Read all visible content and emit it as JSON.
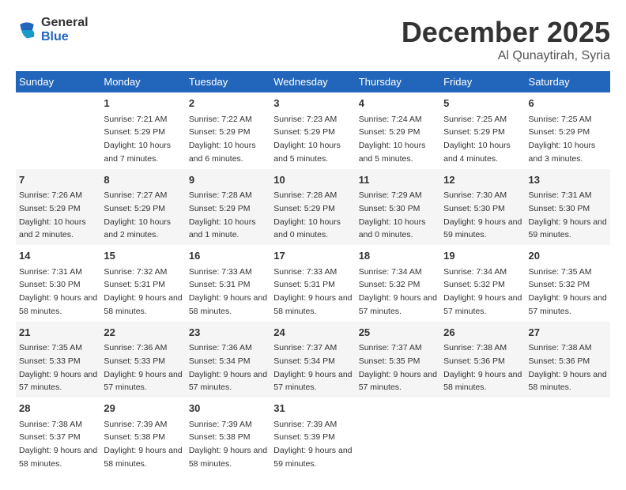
{
  "header": {
    "logo_line1": "General",
    "logo_line2": "Blue",
    "month": "December 2025",
    "location": "Al Qunaytirah, Syria"
  },
  "weekdays": [
    "Sunday",
    "Monday",
    "Tuesday",
    "Wednesday",
    "Thursday",
    "Friday",
    "Saturday"
  ],
  "weeks": [
    [
      {
        "day": "",
        "sunrise": "",
        "sunset": "",
        "daylight": ""
      },
      {
        "day": "1",
        "sunrise": "Sunrise: 7:21 AM",
        "sunset": "Sunset: 5:29 PM",
        "daylight": "Daylight: 10 hours and 7 minutes."
      },
      {
        "day": "2",
        "sunrise": "Sunrise: 7:22 AM",
        "sunset": "Sunset: 5:29 PM",
        "daylight": "Daylight: 10 hours and 6 minutes."
      },
      {
        "day": "3",
        "sunrise": "Sunrise: 7:23 AM",
        "sunset": "Sunset: 5:29 PM",
        "daylight": "Daylight: 10 hours and 5 minutes."
      },
      {
        "day": "4",
        "sunrise": "Sunrise: 7:24 AM",
        "sunset": "Sunset: 5:29 PM",
        "daylight": "Daylight: 10 hours and 5 minutes."
      },
      {
        "day": "5",
        "sunrise": "Sunrise: 7:25 AM",
        "sunset": "Sunset: 5:29 PM",
        "daylight": "Daylight: 10 hours and 4 minutes."
      },
      {
        "day": "6",
        "sunrise": "Sunrise: 7:25 AM",
        "sunset": "Sunset: 5:29 PM",
        "daylight": "Daylight: 10 hours and 3 minutes."
      }
    ],
    [
      {
        "day": "7",
        "sunrise": "Sunrise: 7:26 AM",
        "sunset": "Sunset: 5:29 PM",
        "daylight": "Daylight: 10 hours and 2 minutes."
      },
      {
        "day": "8",
        "sunrise": "Sunrise: 7:27 AM",
        "sunset": "Sunset: 5:29 PM",
        "daylight": "Daylight: 10 hours and 2 minutes."
      },
      {
        "day": "9",
        "sunrise": "Sunrise: 7:28 AM",
        "sunset": "Sunset: 5:29 PM",
        "daylight": "Daylight: 10 hours and 1 minute."
      },
      {
        "day": "10",
        "sunrise": "Sunrise: 7:28 AM",
        "sunset": "Sunset: 5:29 PM",
        "daylight": "Daylight: 10 hours and 0 minutes."
      },
      {
        "day": "11",
        "sunrise": "Sunrise: 7:29 AM",
        "sunset": "Sunset: 5:30 PM",
        "daylight": "Daylight: 10 hours and 0 minutes."
      },
      {
        "day": "12",
        "sunrise": "Sunrise: 7:30 AM",
        "sunset": "Sunset: 5:30 PM",
        "daylight": "Daylight: 9 hours and 59 minutes."
      },
      {
        "day": "13",
        "sunrise": "Sunrise: 7:31 AM",
        "sunset": "Sunset: 5:30 PM",
        "daylight": "Daylight: 9 hours and 59 minutes."
      }
    ],
    [
      {
        "day": "14",
        "sunrise": "Sunrise: 7:31 AM",
        "sunset": "Sunset: 5:30 PM",
        "daylight": "Daylight: 9 hours and 58 minutes."
      },
      {
        "day": "15",
        "sunrise": "Sunrise: 7:32 AM",
        "sunset": "Sunset: 5:31 PM",
        "daylight": "Daylight: 9 hours and 58 minutes."
      },
      {
        "day": "16",
        "sunrise": "Sunrise: 7:33 AM",
        "sunset": "Sunset: 5:31 PM",
        "daylight": "Daylight: 9 hours and 58 minutes."
      },
      {
        "day": "17",
        "sunrise": "Sunrise: 7:33 AM",
        "sunset": "Sunset: 5:31 PM",
        "daylight": "Daylight: 9 hours and 58 minutes."
      },
      {
        "day": "18",
        "sunrise": "Sunrise: 7:34 AM",
        "sunset": "Sunset: 5:32 PM",
        "daylight": "Daylight: 9 hours and 57 minutes."
      },
      {
        "day": "19",
        "sunrise": "Sunrise: 7:34 AM",
        "sunset": "Sunset: 5:32 PM",
        "daylight": "Daylight: 9 hours and 57 minutes."
      },
      {
        "day": "20",
        "sunrise": "Sunrise: 7:35 AM",
        "sunset": "Sunset: 5:32 PM",
        "daylight": "Daylight: 9 hours and 57 minutes."
      }
    ],
    [
      {
        "day": "21",
        "sunrise": "Sunrise: 7:35 AM",
        "sunset": "Sunset: 5:33 PM",
        "daylight": "Daylight: 9 hours and 57 minutes."
      },
      {
        "day": "22",
        "sunrise": "Sunrise: 7:36 AM",
        "sunset": "Sunset: 5:33 PM",
        "daylight": "Daylight: 9 hours and 57 minutes."
      },
      {
        "day": "23",
        "sunrise": "Sunrise: 7:36 AM",
        "sunset": "Sunset: 5:34 PM",
        "daylight": "Daylight: 9 hours and 57 minutes."
      },
      {
        "day": "24",
        "sunrise": "Sunrise: 7:37 AM",
        "sunset": "Sunset: 5:34 PM",
        "daylight": "Daylight: 9 hours and 57 minutes."
      },
      {
        "day": "25",
        "sunrise": "Sunrise: 7:37 AM",
        "sunset": "Sunset: 5:35 PM",
        "daylight": "Daylight: 9 hours and 57 minutes."
      },
      {
        "day": "26",
        "sunrise": "Sunrise: 7:38 AM",
        "sunset": "Sunset: 5:36 PM",
        "daylight": "Daylight: 9 hours and 58 minutes."
      },
      {
        "day": "27",
        "sunrise": "Sunrise: 7:38 AM",
        "sunset": "Sunset: 5:36 PM",
        "daylight": "Daylight: 9 hours and 58 minutes."
      }
    ],
    [
      {
        "day": "28",
        "sunrise": "Sunrise: 7:38 AM",
        "sunset": "Sunset: 5:37 PM",
        "daylight": "Daylight: 9 hours and 58 minutes."
      },
      {
        "day": "29",
        "sunrise": "Sunrise: 7:39 AM",
        "sunset": "Sunset: 5:38 PM",
        "daylight": "Daylight: 9 hours and 58 minutes."
      },
      {
        "day": "30",
        "sunrise": "Sunrise: 7:39 AM",
        "sunset": "Sunset: 5:38 PM",
        "daylight": "Daylight: 9 hours and 58 minutes."
      },
      {
        "day": "31",
        "sunrise": "Sunrise: 7:39 AM",
        "sunset": "Sunset: 5:39 PM",
        "daylight": "Daylight: 9 hours and 59 minutes."
      },
      {
        "day": "",
        "sunrise": "",
        "sunset": "",
        "daylight": ""
      },
      {
        "day": "",
        "sunrise": "",
        "sunset": "",
        "daylight": ""
      },
      {
        "day": "",
        "sunrise": "",
        "sunset": "",
        "daylight": ""
      }
    ]
  ]
}
